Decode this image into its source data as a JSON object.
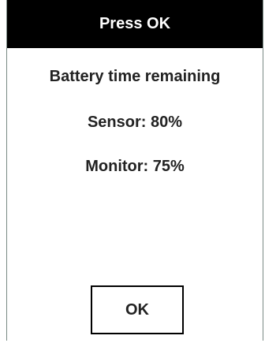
{
  "header": {
    "title": "Press OK"
  },
  "content": {
    "heading": "Battery time remaining",
    "sensor": "Sensor:  80%",
    "monitor": "Monitor:  75%"
  },
  "actions": {
    "ok_label": "OK"
  },
  "colors": {
    "title_bar_bg": "#000000",
    "title_bar_text": "#ffffff",
    "body_text": "#222222",
    "border": "#7a8a85"
  }
}
